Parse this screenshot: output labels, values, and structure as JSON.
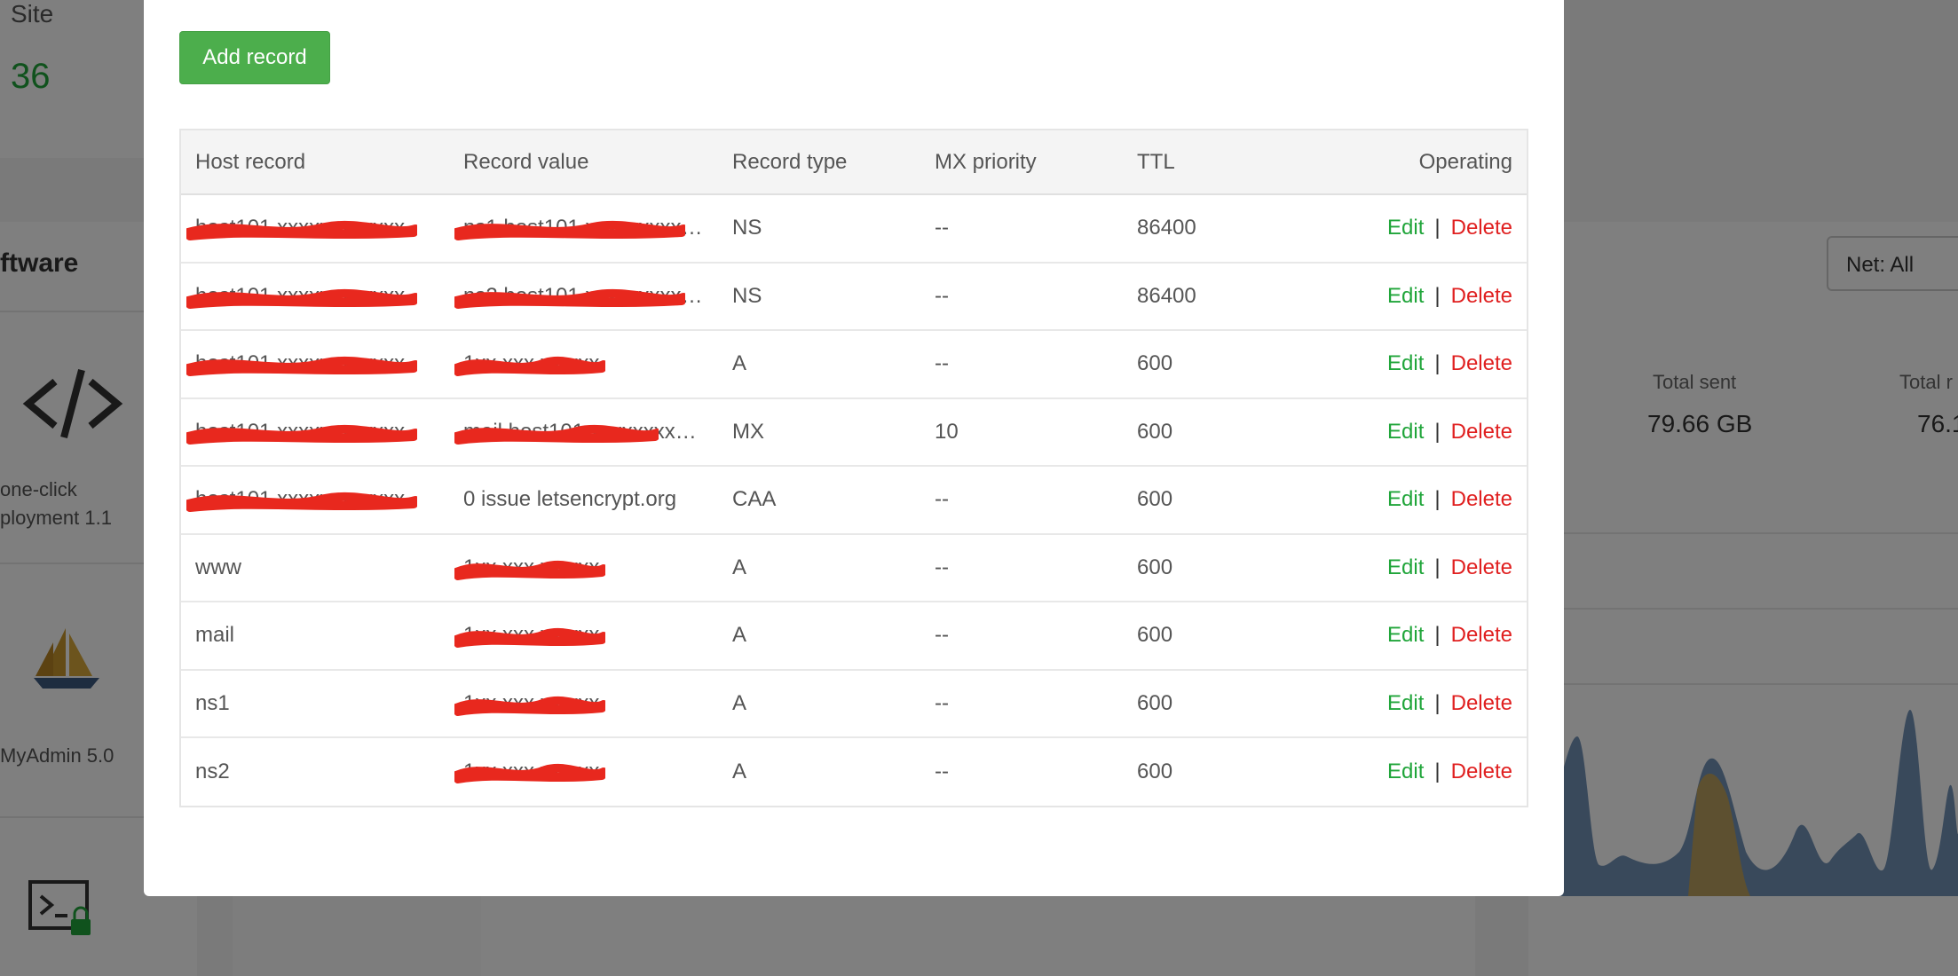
{
  "background": {
    "site_label": "Site",
    "site_count": "36",
    "software_heading": "ftware",
    "tile1_line1": "one-click",
    "tile1_line2": "ployment 1.1",
    "tile2_label": "MyAdmin 5.0",
    "net_select": "Net: All",
    "total_sent_label": "Total sent",
    "total_sent_value": "79.66 GB",
    "total_received_label": "Total r",
    "total_received_value": "76.1"
  },
  "modal": {
    "add_button": "Add record",
    "columns": [
      "Host record",
      "Record value",
      "Record type",
      "MX priority",
      "TTL",
      "Operating"
    ],
    "edit_label": "Edit",
    "separator": "|",
    "delete_label": "Delete",
    "rows": [
      {
        "host": "host101.xxxxxxxxxxxx",
        "value": "ns1.host101.xxxxxxxxxxxt...",
        "type": "NS",
        "mx": "--",
        "ttl": "86400"
      },
      {
        "host": "host101.xxxxxxxxxxxx",
        "value": "ns2.host101.xxxxxxxxxxx...",
        "type": "NS",
        "mx": "--",
        "ttl": "86400"
      },
      {
        "host": "host101.xxxxxxxxxxxx",
        "value": "1xx.xxx.xx.xxx",
        "type": "A",
        "mx": "--",
        "ttl": "600"
      },
      {
        "host": "host101.xxxxxxxxxxxx",
        "value": "mail.host101.xxxxxxxxxx...",
        "type": "MX",
        "mx": "10",
        "ttl": "600"
      },
      {
        "host": "host101.xxxxxxxxxxxx",
        "value": "0  issue  letsencrypt.org",
        "type": "CAA",
        "mx": "--",
        "ttl": "600"
      },
      {
        "host": "www",
        "value": "1xx.xxx.xx.xxx",
        "type": "A",
        "mx": "--",
        "ttl": "600"
      },
      {
        "host": "mail",
        "value": "1xx.xxx.xx.xxx",
        "type": "A",
        "mx": "--",
        "ttl": "600"
      },
      {
        "host": "ns1",
        "value": "1xx.xxx.xx.xxx",
        "type": "A",
        "mx": "--",
        "ttl": "600"
      },
      {
        "host": "ns2",
        "value": "1xx.xxx.xx.xxx",
        "type": "A",
        "mx": "--",
        "ttl": "600"
      }
    ]
  },
  "colors": {
    "accent_green": "#20a53a",
    "button_green": "#4cae4c",
    "delete_red": "#e02020",
    "redaction_red": "#e8281e"
  }
}
